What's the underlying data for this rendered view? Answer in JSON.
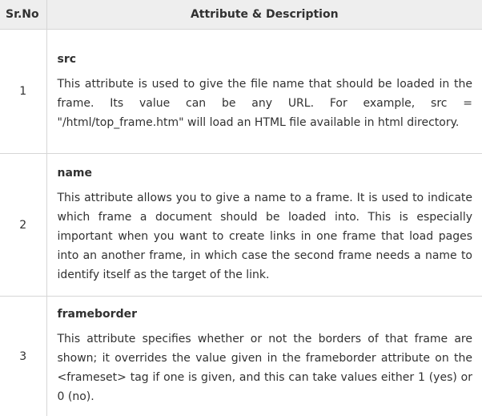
{
  "table": {
    "headers": {
      "srno": "Sr.No",
      "description": "Attribute & Description"
    },
    "rows": [
      {
        "num": "1",
        "name": "src",
        "description": "This attribute is used to give the file name that should be loaded in the frame. Its value can be any URL. For example, src = \"/html/top_frame.htm\" will load an HTML file available in html directory."
      },
      {
        "num": "2",
        "name": "name",
        "description": "This attribute allows you to give a name to a frame. It is used to indicate which frame a document should be loaded into. This is especially important when you want to create links in one frame that load pages into an another frame, in which case the second frame needs a name to identify itself as the target of the link."
      },
      {
        "num": "3",
        "name": "frameborder",
        "description": "This attribute specifies whether or not the borders of that frame are shown; it overrides the value given in the frameborder attribute on the <frameset> tag if one is given, and this can take values either 1 (yes) or 0 (no)."
      }
    ]
  }
}
